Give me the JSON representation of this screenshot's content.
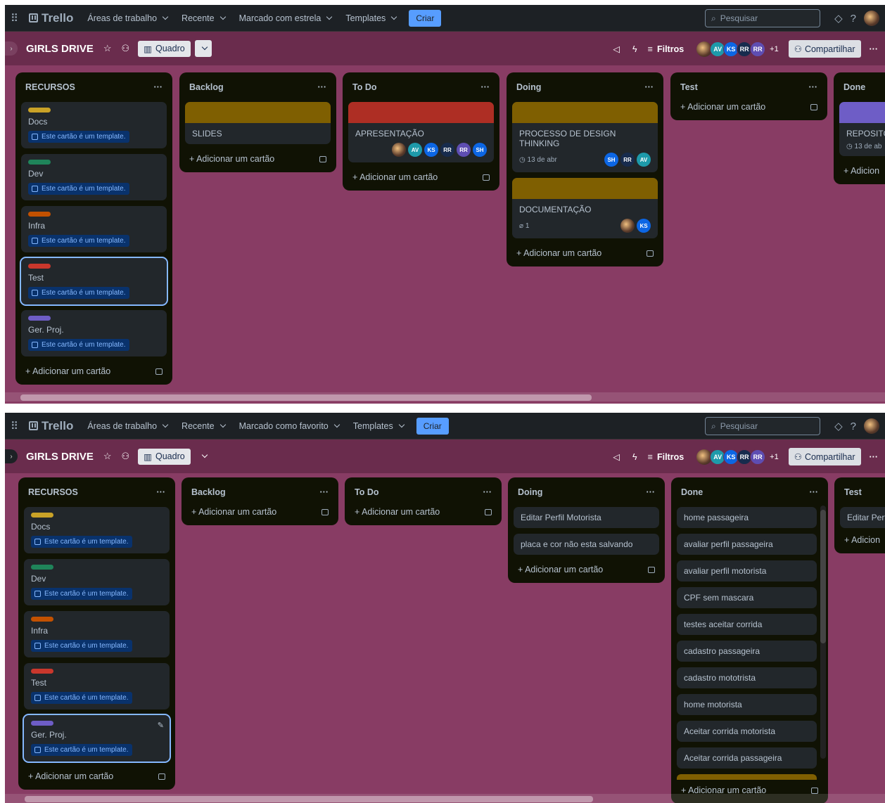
{
  "colors": {
    "board_bg": "#883c64",
    "accent": "#579dff",
    "label_yellow": "#c9a227",
    "label_green": "#1f845a",
    "label_orange": "#c25100",
    "label_red": "#c9372c",
    "label_purple": "#6e5dc6"
  },
  "screens": [
    {
      "nav": {
        "items": [
          "Áreas de trabalho",
          "Recente",
          "Marcado com estrela",
          "Templates"
        ],
        "criar": "Criar",
        "search": "Pesquisar",
        "logo": "Trello"
      },
      "board": {
        "name": "GIRLS DRIVE",
        "view": "Quadro",
        "filtros": "Filtros",
        "share": "Compartilhar",
        "plus": "+1",
        "avatars": [
          "AV",
          "KS",
          "RR",
          "RR"
        ]
      },
      "lists": [
        {
          "title": "RECURSOS",
          "cards": [
            {
              "label": "yellow",
              "text": "Docs",
              "tpl": "Este cartão é um template."
            },
            {
              "label": "green",
              "text": "Dev",
              "tpl": "Este cartão é um template."
            },
            {
              "label": "orange",
              "text": "Infra",
              "tpl": "Este cartão é um template."
            },
            {
              "label": "red",
              "text": "Test",
              "tpl": "Este cartão é um template."
            },
            {
              "label": "purple",
              "text": "Ger. Proj.",
              "tpl": "Este cartão é um template."
            }
          ],
          "add": "Adicionar um cartão"
        },
        {
          "title": "Backlog",
          "cards": [
            {
              "text": "SLIDES"
            }
          ],
          "add": "Adicionar um cartão"
        },
        {
          "title": "To Do",
          "cards": [
            {
              "text": "APRESENTAÇÃO",
              "members": [
                "AV",
                "KS",
                "RR",
                "RR",
                "SH"
              ]
            }
          ],
          "add": "Adicionar um cartão"
        },
        {
          "title": "Doing",
          "cards": [
            {
              "text": "PROCESSO DE DESIGN THINKING",
              "date": "13 de abr",
              "members": [
                "SH",
                "RR",
                "AV"
              ]
            },
            {
              "text": "DOCUMENTAÇÃO",
              "attach": "1",
              "members": [
                "KS"
              ]
            }
          ],
          "add": "Adicionar um cartão"
        },
        {
          "title": "Test",
          "add": "Adicionar um cartão"
        },
        {
          "title": "Done",
          "cards": [
            {
              "text": "REPOSITÓR",
              "date": "13 de ab"
            }
          ],
          "add": "Adicion"
        }
      ]
    },
    {
      "nav": {
        "items": [
          "Áreas de trabalho",
          "Recente",
          "Marcado como favorito",
          "Templates"
        ],
        "criar": "Criar",
        "search": "Pesquisar",
        "logo": "Trello"
      },
      "board": {
        "name": "GIRLS DRIVE",
        "view": "Quadro",
        "filtros": "Filtros",
        "share": "Compartilhar",
        "plus": "+1",
        "avatars": [
          "AV",
          "KS",
          "RR",
          "RR"
        ]
      },
      "lists": [
        {
          "title": "RECURSOS",
          "cards": [
            {
              "label": "yellow",
              "text": "Docs",
              "tpl": "Este cartão é um template."
            },
            {
              "label": "green",
              "text": "Dev",
              "tpl": "Este cartão é um template."
            },
            {
              "label": "orange",
              "text": "Infra",
              "tpl": "Este cartão é um template."
            },
            {
              "label": "red",
              "text": "Test",
              "tpl": "Este cartão é um template."
            },
            {
              "label": "purple",
              "text": "Ger. Proj.",
              "tpl": "Este cartão é um template."
            }
          ],
          "add": "Adicionar um cartão"
        },
        {
          "title": "Backlog",
          "add": "Adicionar um cartão"
        },
        {
          "title": "To Do",
          "add": "Adicionar um cartão"
        },
        {
          "title": "Doing",
          "cards": [
            "Editar Perfil Motorista",
            "placa e cor não esta salvando"
          ],
          "add": "Adicionar um cartão"
        },
        {
          "title": "Done",
          "cards": [
            "home passageira",
            "avaliar perfil passageira",
            "avaliar perfil motorista",
            "CPF sem mascara",
            "testes aceitar corrida",
            "cadastro passageira",
            "cadastro mototrista",
            "home motorista",
            "Aceitar corrida motorista",
            "Aceitar corrida passageira"
          ],
          "add": "Adicionar um cartão"
        },
        {
          "title": "Test",
          "cards": [
            "Editar Perfil"
          ],
          "add": "Adicion"
        }
      ]
    }
  ]
}
